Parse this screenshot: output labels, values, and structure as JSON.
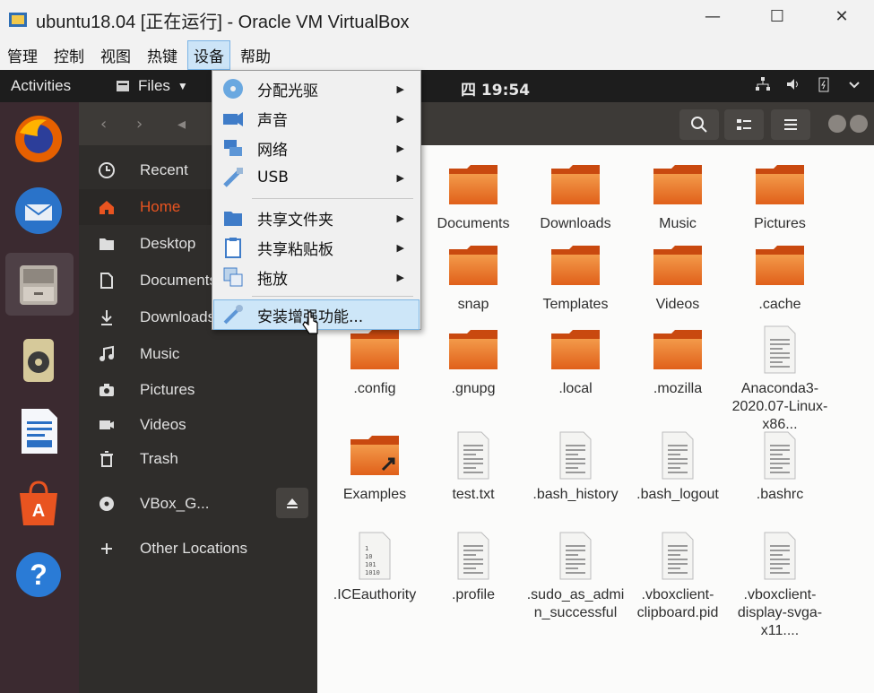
{
  "window": {
    "title": "ubuntu18.04 [正在运行] - Oracle VM VirtualBox",
    "min_glyph": "—",
    "max_glyph": "☐",
    "close_glyph": "✕"
  },
  "menubar": {
    "items": [
      "管理",
      "控制",
      "视图",
      "热键",
      "设备",
      "帮助"
    ],
    "active_index": 4
  },
  "topbar": {
    "activities": "Activities",
    "app_name": "Files",
    "clock": "四 19:54"
  },
  "devices_menu": {
    "items": [
      {
        "label": "分配光驱",
        "icon": "optical-drive-icon",
        "submenu": true
      },
      {
        "label": "声音",
        "icon": "audio-icon",
        "submenu": true
      },
      {
        "label": "网络",
        "icon": "network-icon",
        "submenu": true
      },
      {
        "label": "USB",
        "icon": "usb-icon",
        "submenu": true
      },
      {
        "label": "共享文件夹",
        "icon": "shared-folder-icon",
        "submenu": true
      },
      {
        "label": "共享粘贴板",
        "icon": "clipboard-icon",
        "submenu": true
      },
      {
        "label": "拖放",
        "icon": "drag-drop-icon",
        "submenu": true
      },
      {
        "label": "安装增强功能...",
        "icon": "install-additions-icon",
        "submenu": false,
        "highlighted": true
      }
    ]
  },
  "sidebar": {
    "items": [
      {
        "label": "Recent",
        "icon": "clock-icon"
      },
      {
        "label": "Home",
        "icon": "home-icon",
        "active": true
      },
      {
        "label": "Desktop",
        "icon": "desktop-folder-icon"
      },
      {
        "label": "Documents",
        "icon": "document-icon"
      },
      {
        "label": "Downloads",
        "icon": "download-icon"
      },
      {
        "label": "Music",
        "icon": "music-icon"
      },
      {
        "label": "Pictures",
        "icon": "camera-icon"
      },
      {
        "label": "Videos",
        "icon": "video-icon"
      },
      {
        "label": "Trash",
        "icon": "trash-icon"
      },
      {
        "label": "VBox_G...",
        "icon": "disc-icon"
      },
      {
        "label": "Other Locations",
        "icon": "plus-icon"
      }
    ]
  },
  "files": [
    {
      "name": "Documents",
      "type": "folder"
    },
    {
      "name": "Downloads",
      "type": "folder"
    },
    {
      "name": "Music",
      "type": "folder"
    },
    {
      "name": "Pictures",
      "type": "folder"
    },
    {
      "name": "snap",
      "type": "folder"
    },
    {
      "name": "Templates",
      "type": "folder"
    },
    {
      "name": "Videos",
      "type": "folder"
    },
    {
      "name": ".cache",
      "type": "folder"
    },
    {
      "name": ".config",
      "type": "folder"
    },
    {
      "name": ".gnupg",
      "type": "folder"
    },
    {
      "name": ".local",
      "type": "folder"
    },
    {
      "name": ".mozilla",
      "type": "folder"
    },
    {
      "name": "Anaconda3-2020.07-Linux-x86...",
      "type": "text"
    },
    {
      "name": "Examples",
      "type": "folder-link"
    },
    {
      "name": "test.txt",
      "type": "text"
    },
    {
      "name": ".bash_history",
      "type": "text"
    },
    {
      "name": ".bash_logout",
      "type": "text"
    },
    {
      "name": ".bashrc",
      "type": "text"
    },
    {
      "name": ".ICEauthority",
      "type": "binary"
    },
    {
      "name": ".profile",
      "type": "text"
    },
    {
      "name": ".sudo_as_admin_successful",
      "type": "text"
    },
    {
      "name": ".vboxclient-clipboard.pid",
      "type": "text"
    },
    {
      "name": ".vboxclient-display-svga-x11....",
      "type": "text"
    }
  ],
  "colors": {
    "ubuntu_orange": "#e95420",
    "menu_highlight": "#cde6f8",
    "dock_bg": "#3b2a30",
    "sidebar_bg": "#2f2d2b"
  }
}
